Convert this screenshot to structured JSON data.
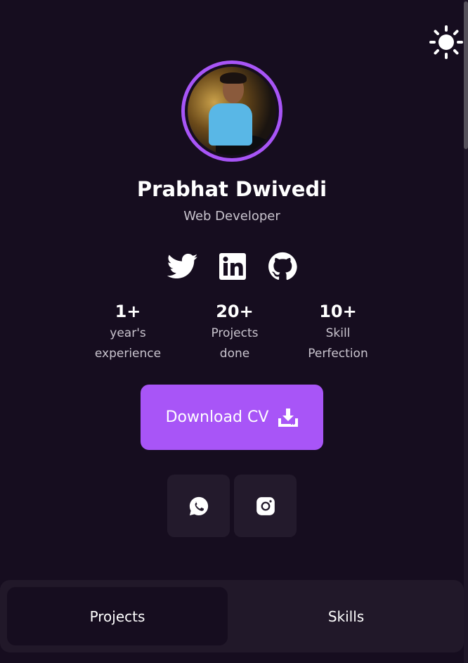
{
  "profile": {
    "name": "Prabhat Dwivedi",
    "role": "Web Developer"
  },
  "socials": [
    {
      "icon": "twitter-icon"
    },
    {
      "icon": "linkedin-icon"
    },
    {
      "icon": "github-icon"
    }
  ],
  "stats": [
    {
      "value": "1+",
      "label_line1": "year's",
      "label_line2": "experience"
    },
    {
      "value": "20+",
      "label_line1": "Projects",
      "label_line2": "done"
    },
    {
      "value": "10+",
      "label_line1": "Skill",
      "label_line2": "Perfection"
    }
  ],
  "download": {
    "label": "Download CV",
    "icon": "download-icon"
  },
  "contacts": [
    {
      "icon": "whatsapp-icon"
    },
    {
      "icon": "instagram-icon"
    }
  ],
  "tabs": [
    {
      "label": "Projects",
      "active": true
    },
    {
      "label": "Skills",
      "active": false
    }
  ],
  "theme": {
    "toggle_icon": "sun-icon",
    "accent": "#a855f7",
    "background": "#160d1f",
    "card": "#231a2c"
  }
}
